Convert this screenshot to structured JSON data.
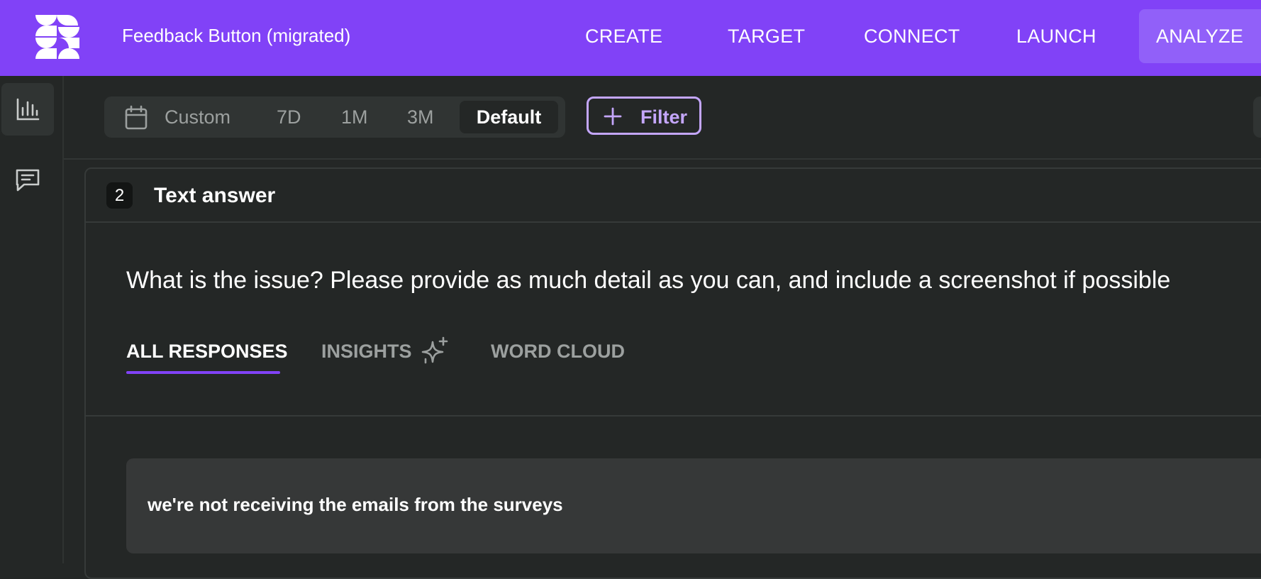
{
  "header": {
    "app_title": "Feedback Button (migrated)",
    "brand_color": "#8142f7",
    "nav": {
      "create": "CREATE",
      "target": "TARGET",
      "connect": "CONNECT",
      "launch": "LAUNCH",
      "analyze": "ANALYZE"
    },
    "active_nav": "ANALYZE"
  },
  "sidebar": {
    "items": [
      {
        "icon": "bar-chart-icon",
        "active": true
      },
      {
        "icon": "message-icon",
        "active": false
      }
    ]
  },
  "date_range": {
    "icon": "calendar-icon",
    "options": {
      "custom": "Custom",
      "d7": "7D",
      "m1": "1M",
      "m3": "3M",
      "default": "Default"
    },
    "selected": "Default"
  },
  "filter": {
    "icon": "plus-icon",
    "label": "Filter"
  },
  "question_card": {
    "number": "2",
    "type": "Text answer",
    "question": "What is the issue? Please provide as much detail as you can, and include a screenshot if possible",
    "tabs": {
      "all_responses": "ALL RESPONSES",
      "insights": "INSIGHTS",
      "word_cloud": "WORD CLOUD"
    },
    "active_tab": "ALL RESPONSES",
    "responses": [
      "we're not receiving the emails from the surveys"
    ]
  }
}
